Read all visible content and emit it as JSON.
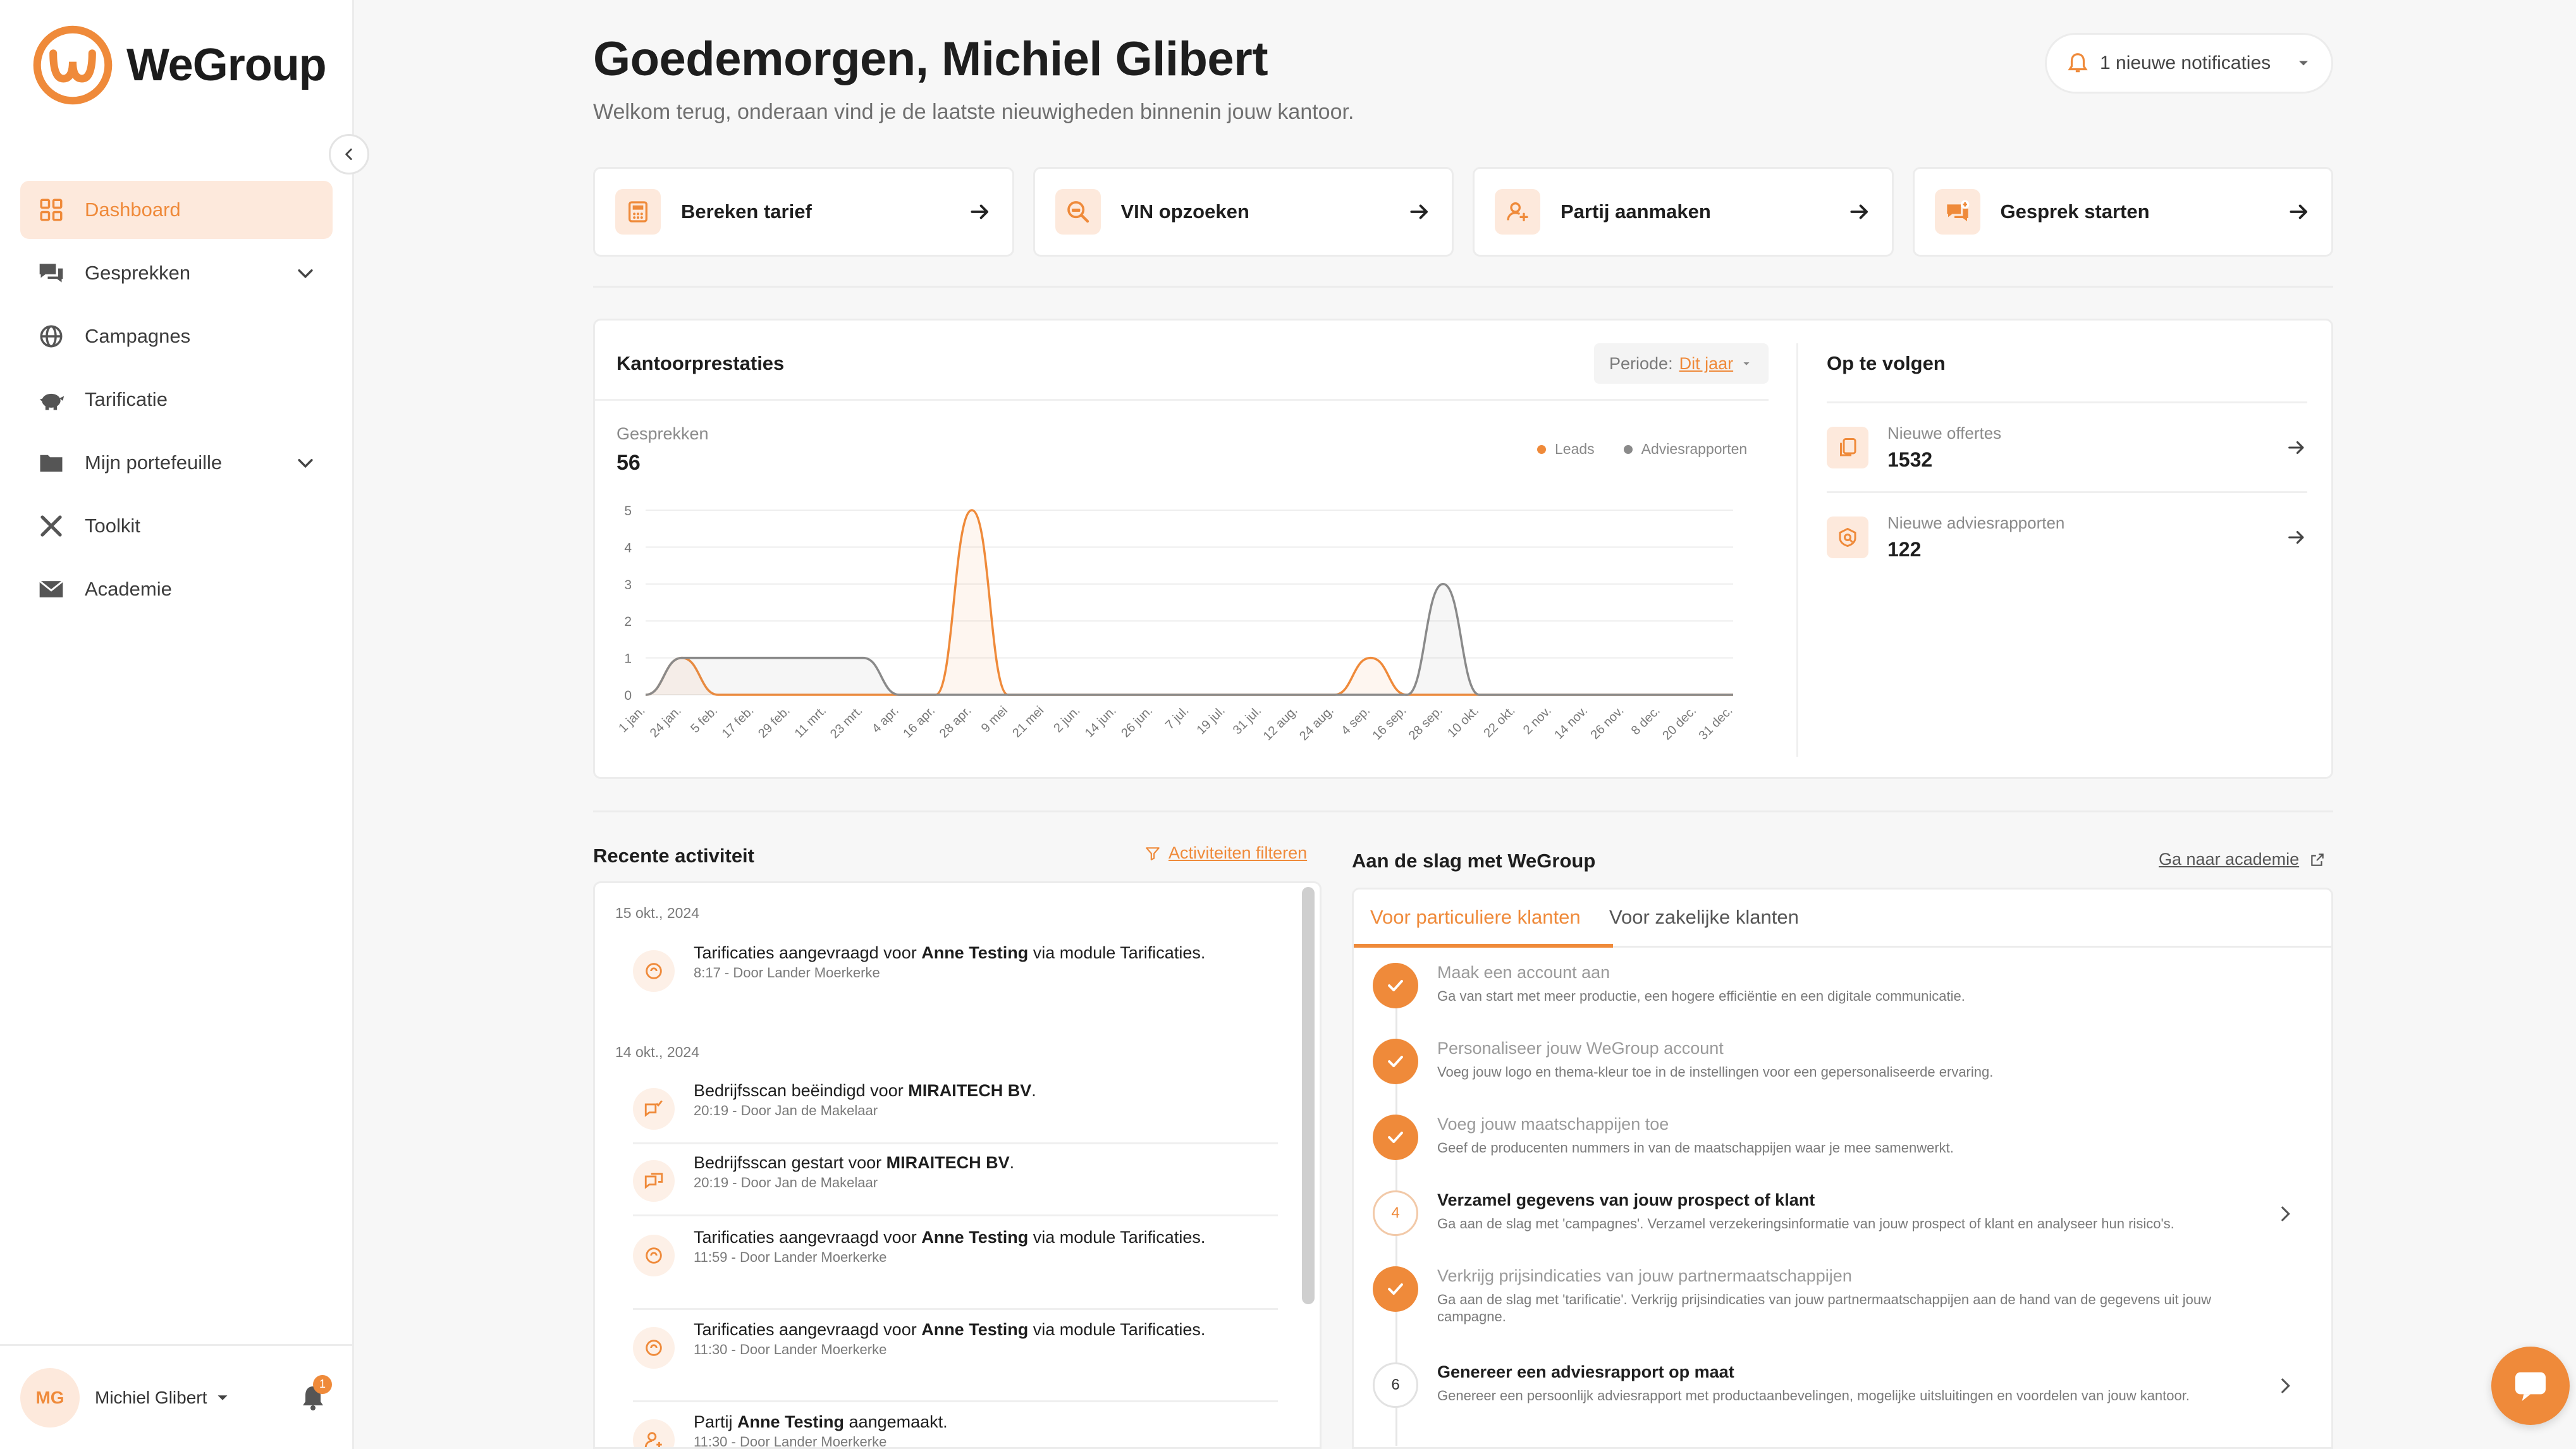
{
  "brand": {
    "name": "WeGroup",
    "accent": "#ef8a3a"
  },
  "sidebar": {
    "items": [
      {
        "label": "Dashboard",
        "icon": "dashboard-icon",
        "active": true
      },
      {
        "label": "Gesprekken",
        "icon": "chat-icon",
        "expandable": true
      },
      {
        "label": "Campagnes",
        "icon": "globe-icon"
      },
      {
        "label": "Tarificatie",
        "icon": "piggy-bank-icon"
      },
      {
        "label": "Mijn portefeuille",
        "icon": "folder-icon",
        "expandable": true
      },
      {
        "label": "Toolkit",
        "icon": "tools-icon"
      },
      {
        "label": "Academie",
        "icon": "mail-icon"
      }
    ],
    "user": {
      "initials": "MG",
      "name": "Michiel Glibert",
      "notification_count": "1"
    }
  },
  "header": {
    "greeting": "Goedemorgen, Michiel Glibert",
    "subtitle": "Welkom terug, onderaan vind je de laatste nieuwigheden binnenin jouw kantoor.",
    "notifications_label": "1 nieuwe notificaties"
  },
  "quick_actions": [
    {
      "label": "Bereken tarief",
      "icon": "calculator-icon"
    },
    {
      "label": "VIN opzoeken",
      "icon": "car-search-icon"
    },
    {
      "label": "Partij aanmaken",
      "icon": "add-user-icon"
    },
    {
      "label": "Gesprek starten",
      "icon": "chat-add-icon"
    }
  ],
  "stats": {
    "title": "Kantoorprestaties",
    "period_label": "Periode:",
    "period_value": "Dit jaar",
    "metric_label": "Gesprekken",
    "metric_value": "56",
    "legend": [
      {
        "name": "Leads",
        "color": "#ef8a3a"
      },
      {
        "name": "Adviesrapporten",
        "color": "#8a8a8a"
      }
    ]
  },
  "chart_data": {
    "type": "area",
    "categories": [
      "1 jan.",
      "24 jan.",
      "5 feb.",
      "17 feb.",
      "29 feb.",
      "11 mrt.",
      "23 mrt.",
      "4 apr.",
      "16 apr.",
      "28 apr.",
      "9 mei",
      "21 mei",
      "2 jun.",
      "14 jun.",
      "26 jun.",
      "7 jul.",
      "19 jul.",
      "31 jul.",
      "12 aug.",
      "24 aug.",
      "4 sep.",
      "16 sep.",
      "28 sep.",
      "10 okt.",
      "22 okt.",
      "2 nov.",
      "14 nov.",
      "26 nov.",
      "8 dec.",
      "20 dec.",
      "31 dec."
    ],
    "series": [
      {
        "name": "Leads",
        "values": [
          0,
          1,
          0,
          0,
          0,
          0,
          0,
          0,
          0,
          5,
          0,
          0,
          0,
          0,
          0,
          0,
          0,
          0,
          0,
          0,
          1,
          0,
          0,
          0,
          0,
          0,
          0,
          0,
          0,
          0,
          0
        ]
      },
      {
        "name": "Adviesrapporten",
        "values": [
          0,
          1,
          1,
          1,
          1,
          1,
          1,
          0,
          0,
          0,
          0,
          0,
          0,
          0,
          0,
          0,
          0,
          0,
          0,
          0,
          0,
          0,
          3,
          0,
          0,
          0,
          0,
          0,
          0,
          0,
          0
        ]
      }
    ],
    "ylim": [
      0,
      5
    ],
    "yticks": [
      "0",
      "1",
      "2",
      "3",
      "4",
      "5"
    ],
    "grid": true,
    "legend_position": "top-right"
  },
  "follow": {
    "title": "Op te volgen",
    "items": [
      {
        "label": "Nieuwe offertes",
        "value": "1532",
        "icon": "documents-icon"
      },
      {
        "label": "Nieuwe adviesrapporten",
        "value": "122",
        "icon": "report-icon"
      }
    ]
  },
  "activity": {
    "title": "Recente activiteit",
    "filter_label": "Activiteiten filteren",
    "dates": [
      "15 okt., 2024",
      "14 okt., 2024"
    ],
    "items": [
      {
        "pre": "Tarificaties aangevraagd voor ",
        "bold": "Anne Testing",
        "post": " via module Tarificaties.",
        "meta": "8:17 - Door Lander Moerkerke"
      },
      {
        "pre": "Bedrijfsscan beëindigd voor ",
        "bold": "MIRAITECH BV",
        "post": ".",
        "meta": "20:19 - Door Jan de Makelaar"
      },
      {
        "pre": "Bedrijfsscan gestart voor ",
        "bold": "MIRAITECH BV",
        "post": ".",
        "meta": "20:19 - Door Jan de Makelaar"
      },
      {
        "pre": "Tarificaties aangevraagd voor ",
        "bold": "Anne Testing",
        "post": " via module Tarificaties.",
        "meta": "11:59 - Door Lander Moerkerke"
      },
      {
        "pre": "Tarificaties aangevraagd voor ",
        "bold": "Anne Testing",
        "post": " via module Tarificaties.",
        "meta": "11:30 - Door Lander Moerkerke"
      },
      {
        "pre": "Partij ",
        "bold": "Anne Testing",
        "post": " aangemaakt.",
        "meta": "11:30 - Door Lander Moerkerke"
      }
    ]
  },
  "getting_started": {
    "title": "Aan de slag met WeGroup",
    "link_label": "Ga naar academie",
    "tabs": [
      "Voor particuliere klanten",
      "Voor zakelijke klanten"
    ],
    "steps": [
      {
        "number": "1",
        "done": true,
        "title": "Maak een account aan",
        "desc": "Ga van start met meer productie, een hogere efficiëntie en een digitale communicatie."
      },
      {
        "number": "2",
        "done": true,
        "title": "Personaliseer jouw WeGroup account",
        "desc": "Voeg jouw logo en thema-kleur toe in de instellingen voor een gepersonaliseerde ervaring."
      },
      {
        "number": "3",
        "done": true,
        "title": "Voeg jouw maatschappijen toe",
        "desc": "Geef de producenten nummers in van de maatschappijen waar je mee samenwerkt."
      },
      {
        "number": "4",
        "done": false,
        "title": "Verzamel gegevens van jouw prospect of klant",
        "desc": "Ga aan de slag met 'campagnes'. Verzamel verzekeringsinformatie van jouw prospect of klant en analyseer hun risico's."
      },
      {
        "number": "5",
        "done": true,
        "title": "Verkrijg prijsindicaties van jouw partnermaatschappijen",
        "desc": "Ga aan de slag met 'tarificatie'. Verkrijg prijsindicaties van jouw partnermaatschappijen aan de hand van de gegevens uit jouw campagne."
      },
      {
        "number": "6",
        "done": false,
        "title": "Genereer een adviesrapport op maat",
        "desc": "Genereer een persoonlijk adviesrapport met productaanbevelingen, mogelijke uitsluitingen en voordelen van jouw kantoor."
      }
    ]
  }
}
